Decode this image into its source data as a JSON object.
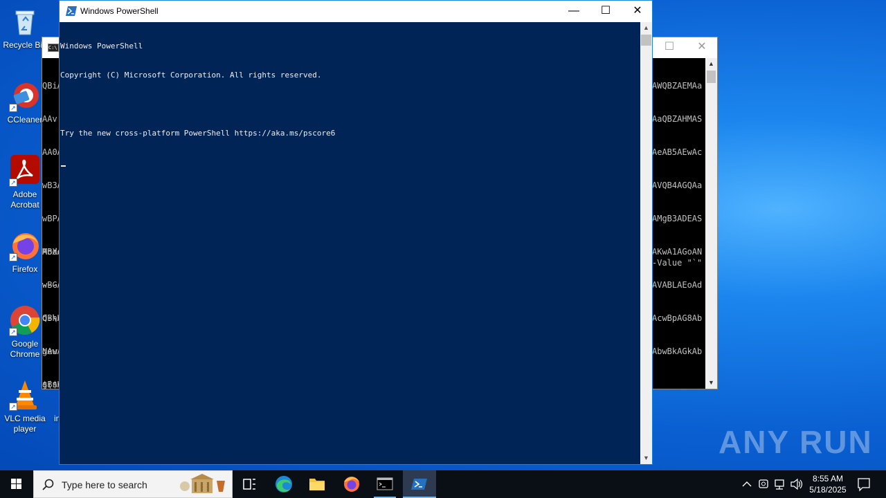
{
  "desktop": {
    "icons": [
      {
        "label": "Recycle Bin"
      },
      {
        "label": "CCleaner"
      },
      {
        "label": "Adobe Acrobat"
      },
      {
        "label": "Firefox"
      },
      {
        "label": "Google Chrome"
      },
      {
        "label": "VLC media player"
      }
    ],
    "extra_label": "in"
  },
  "cmd_window": {
    "left_lines": [
      "QBiA",
      "AAv",
      "AA0A",
      "wB3A",
      "wBPA",
      "ABXA",
      "wBGA",
      "QBhA",
      "gAuA",
      "gBnA"
    ],
    "left_lines2": [
      "Mode",
      "----",
      "d---",
      "New",
      "$($H"
    ],
    "left_prompt": "C:\\U",
    "right_lines": [
      "AWQBZAEMAa",
      "AaQBZAHMAS",
      "AeAB5AEwAc",
      "AVQB4AGQAa",
      "AMgB3ADEAS",
      "AKwA1AGoAN",
      "AVABLAEoAd",
      "AcwBpAG8Ab",
      "AbwBkAGkAb"
    ],
    "right_value": "-Value \"`\""
  },
  "powershell": {
    "title": "Windows PowerShell",
    "console_lines": [
      "Windows PowerShell",
      "Copyright (C) Microsoft Corporation. All rights reserved.",
      "",
      "Try the new cross-platform PowerShell https://aka.ms/pscore6"
    ]
  },
  "watermark": "ANY RUN",
  "taskbar": {
    "search_placeholder": "Type here to search",
    "time": "8:55 AM",
    "date": "5/18/2025"
  }
}
